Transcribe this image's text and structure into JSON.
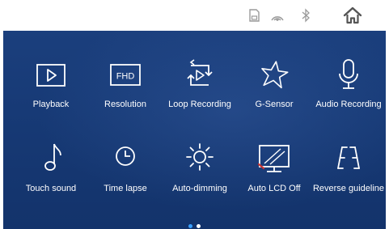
{
  "status_bar": {
    "icons": [
      "sd-card-icon",
      "gps-signal-icon",
      "bluetooth-icon",
      "home-icon"
    ]
  },
  "menu": {
    "items": [
      {
        "label": "Playback",
        "icon": "playback-icon"
      },
      {
        "label": "Resolution",
        "icon": "fhd-resolution-icon",
        "icon_text": "FHD"
      },
      {
        "label": "Loop Recording",
        "icon": "loop-recording-icon"
      },
      {
        "label": "G-Sensor",
        "icon": "g-sensor-icon"
      },
      {
        "label": "Audio Recording",
        "icon": "microphone-icon"
      },
      {
        "label": "Touch sound",
        "icon": "music-note-icon"
      },
      {
        "label": "Time lapse",
        "icon": "clock-icon"
      },
      {
        "label": "Auto-dimming",
        "icon": "brightness-icon"
      },
      {
        "label": "Auto LCD Off",
        "icon": "lcd-off-icon"
      },
      {
        "label": "Reverse guideline",
        "icon": "reverse-guideline-icon"
      }
    ]
  },
  "pagination": {
    "current_page": 1,
    "total_pages": 2
  },
  "colors": {
    "panel_background": "#173a76",
    "icon_color": "#ffffff",
    "status_icon_color": "#9a9a9a",
    "active_dot": "#3aa0ff",
    "inactive_dot": "#ffffff"
  }
}
